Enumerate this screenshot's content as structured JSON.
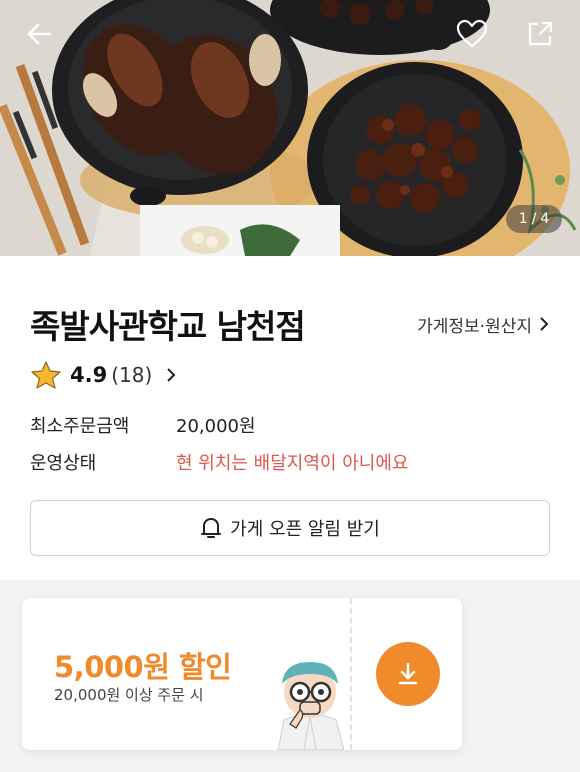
{
  "header": {
    "pager_current": "1",
    "pager_sep": "/",
    "pager_total": "4"
  },
  "store": {
    "name": "족발사관학교 남천점",
    "info_link": "가게정보·원산지",
    "rating": "4.9",
    "review_count": "(18)"
  },
  "details": {
    "min_order_label": "최소주문금액",
    "min_order_value": "20,000원",
    "status_label": "운영상태",
    "status_value": "현 위치는 배달지역이 아니에요"
  },
  "notify": {
    "label": "가게 오픈 알림 받기"
  },
  "coupon": {
    "amount": "5,000원 할인",
    "condition": "20,000원 이상 주문 시"
  },
  "colors": {
    "accent": "#f08a2a",
    "warning": "#e2574c",
    "star": "#f5b82e"
  },
  "icons": {
    "back": "back-arrow-icon",
    "favorite": "heart-icon",
    "share": "share-icon",
    "notify": "bell-icon",
    "download": "download-icon",
    "chevron": "chevron-right-icon",
    "star": "star-icon"
  }
}
